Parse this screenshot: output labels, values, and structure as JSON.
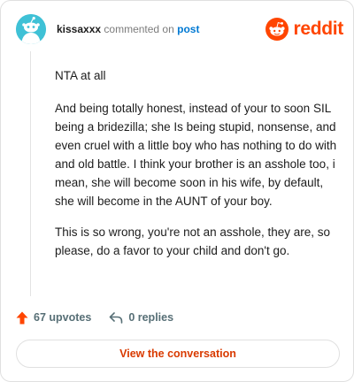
{
  "comment": {
    "author": "kissaxxx",
    "action_text": "commented on",
    "target_text": "post",
    "paragraphs": [
      "NTA at all",
      "And being totally honest, instead of your to soon SIL being a bridezilla; she Is being stupid, nonsense, and even cruel with a little boy who has nothing to do with and old battle. I think your brother is an asshole too, i mean, she will become soon in his wife, by default, she will become in the AUNT of your boy.",
      "This is so wrong, you're not an asshole, they are, so please, do a favor to your child and don't go."
    ]
  },
  "brand": {
    "name": "reddit",
    "icon": "reddit-alien-icon",
    "color": "#ff4500"
  },
  "avatar": {
    "icon": "snoo-avatar-icon",
    "color": "#3fc1d6"
  },
  "footer": {
    "upvotes_label": "67 upvotes",
    "upvote_icon": "upvote-arrow-icon",
    "upvote_color": "#ff4500",
    "replies_label": "0 replies",
    "reply_icon": "reply-arrow-icon"
  },
  "cta": {
    "label": "View the conversation",
    "color": "#d93a00"
  }
}
